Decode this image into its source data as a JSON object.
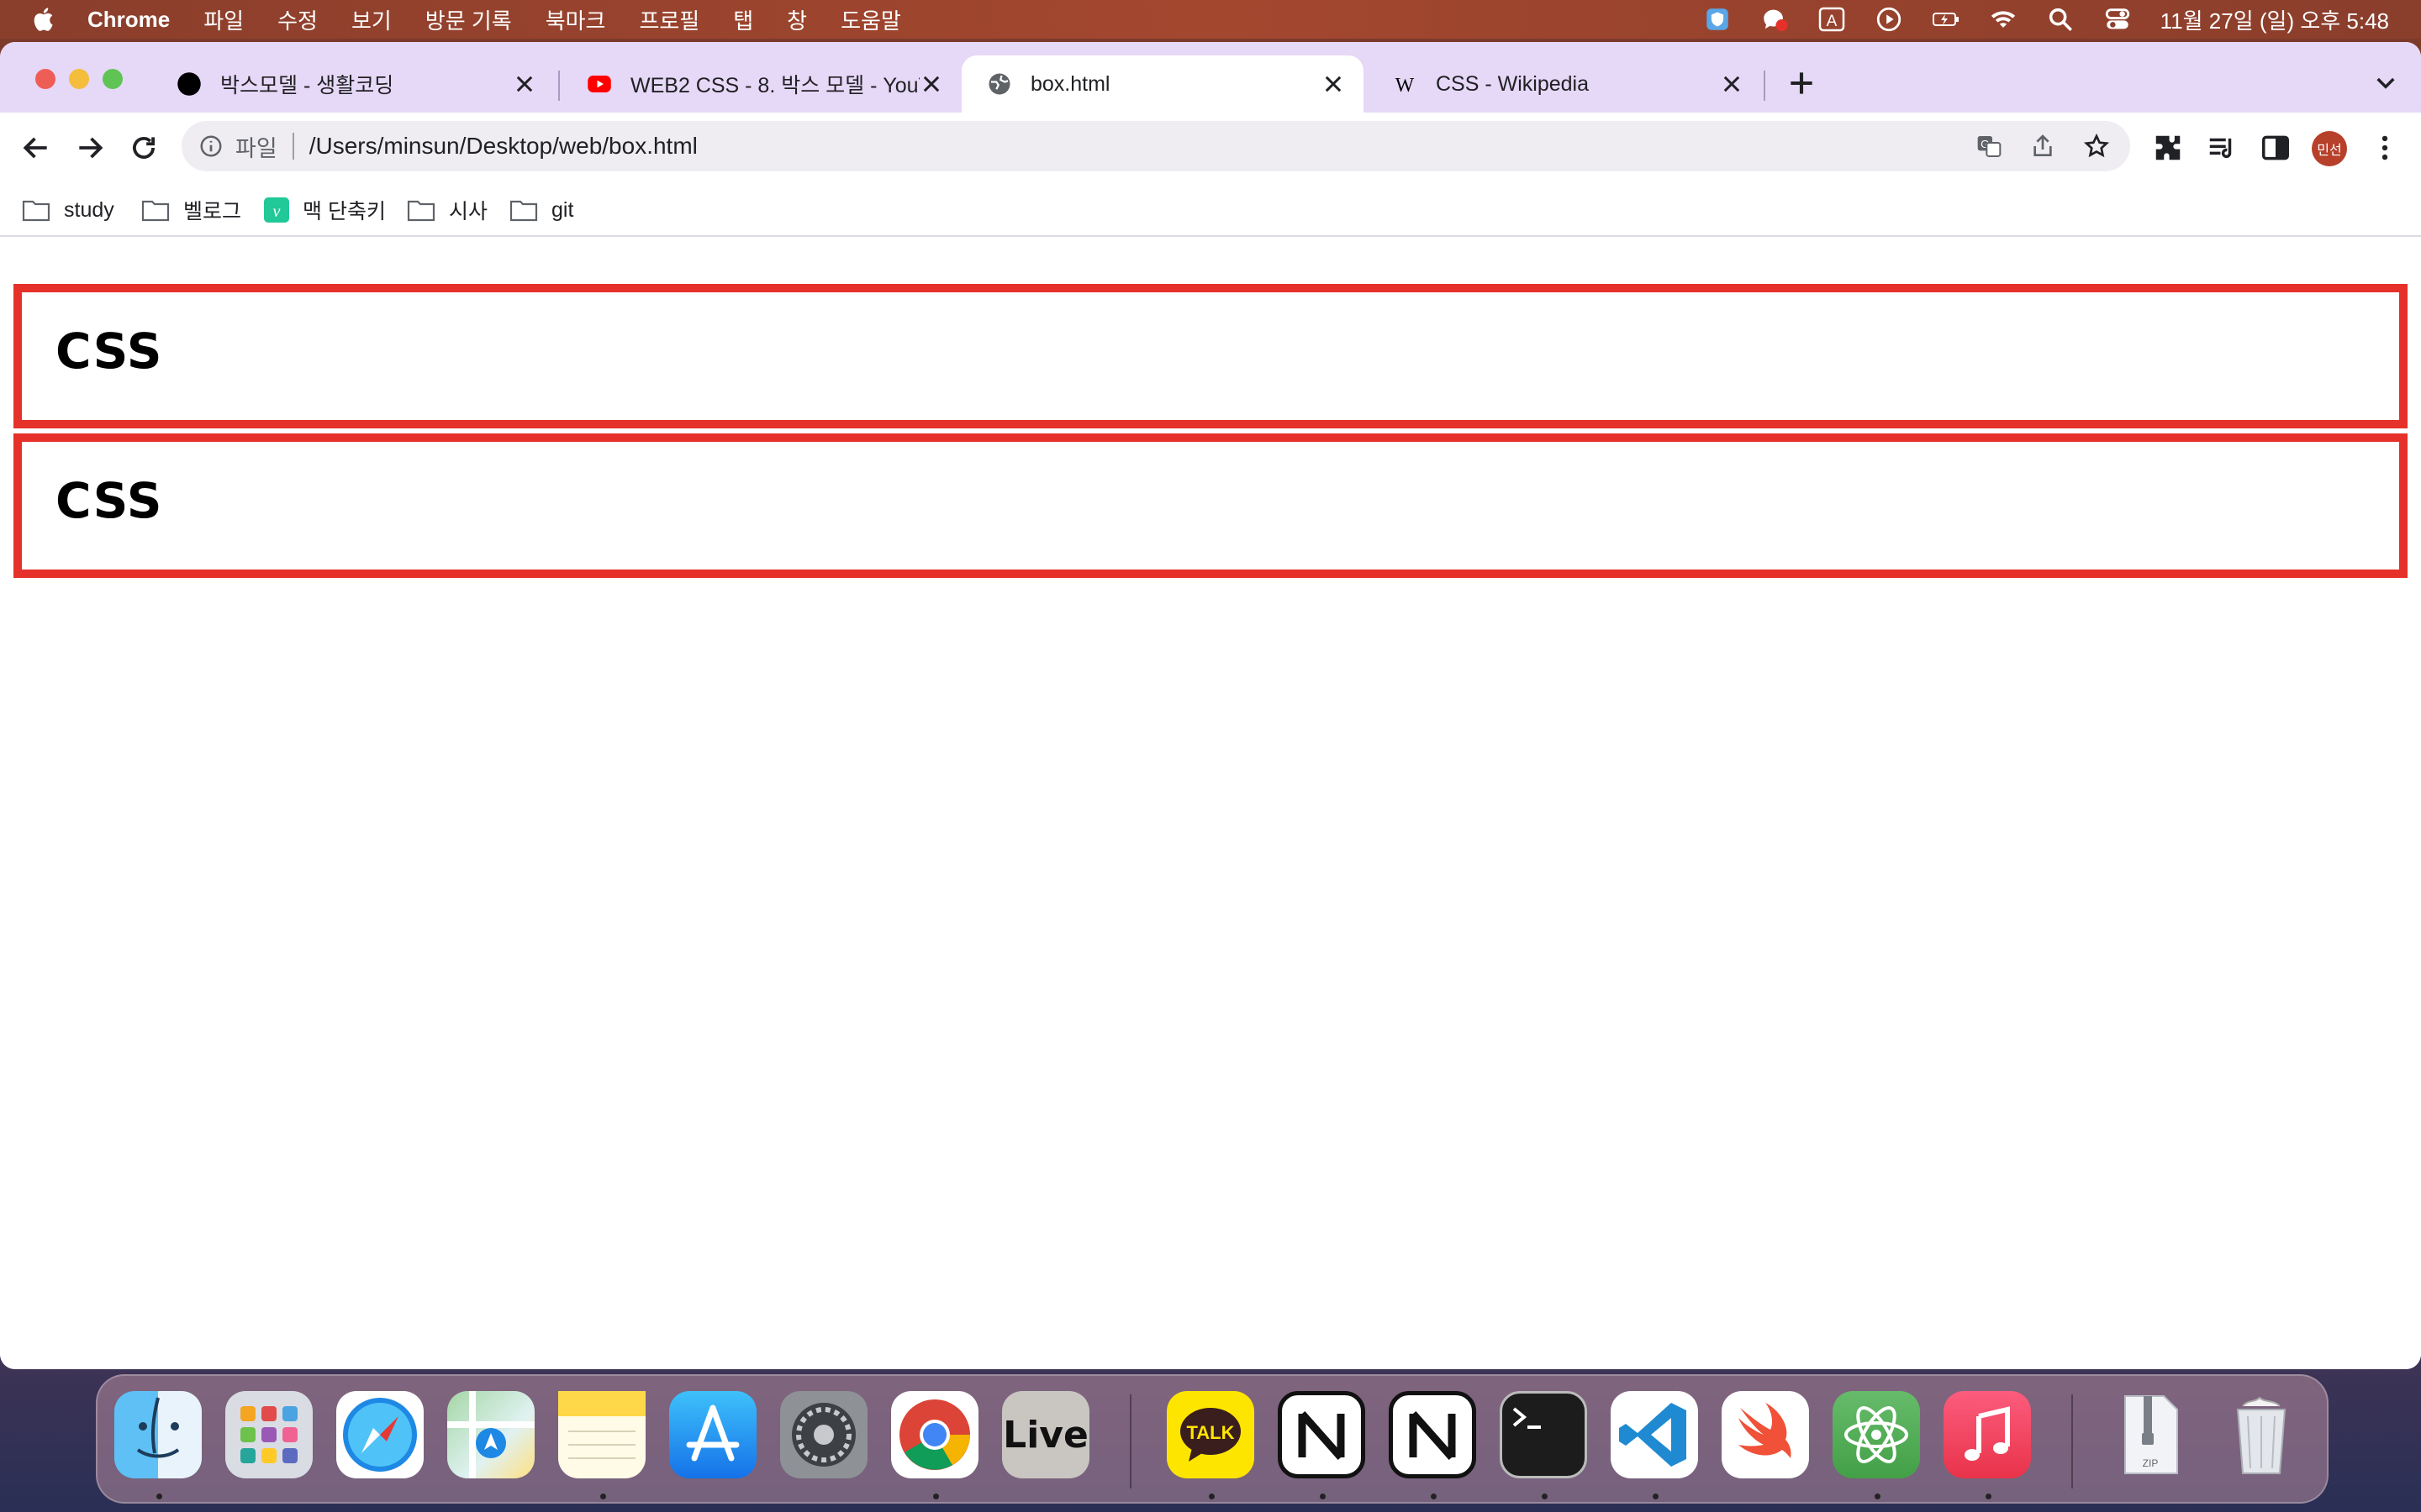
{
  "menubar": {
    "app": "Chrome",
    "items": [
      "파일",
      "수정",
      "보기",
      "방문 기록",
      "북마크",
      "프로필",
      "탭",
      "창",
      "도움말"
    ],
    "clock": "11월 27일 (일) 오후 5:48",
    "input_indicator": "A"
  },
  "tabs": [
    {
      "title": "박스모델 - 생활코딩",
      "icon": "black-circle-icon"
    },
    {
      "title": "WEB2 CSS - 8. 박스 모델 - YouTube",
      "icon": "youtube-icon"
    },
    {
      "title": "box.html",
      "icon": "globe-icon",
      "active": true
    },
    {
      "title": "CSS - Wikipedia",
      "icon": "wikipedia-icon"
    }
  ],
  "omnibox": {
    "scheme_label": "파일",
    "url": "/Users/minsun/Desktop/web/box.html"
  },
  "profile": {
    "initials": "민선"
  },
  "bookmarks": [
    {
      "label": "study",
      "icon": "folder-icon"
    },
    {
      "label": "벨로그",
      "icon": "folder-icon"
    },
    {
      "label": "맥 단축키",
      "icon": "velog-icon"
    },
    {
      "label": "시사",
      "icon": "folder-icon"
    },
    {
      "label": "git",
      "icon": "folder-icon"
    }
  ],
  "page": {
    "headings": [
      "CSS",
      "CSS"
    ],
    "box_border_color": "#e5312a"
  },
  "dock": {
    "apps": [
      "Finder",
      "Launchpad",
      "Safari",
      "Maps",
      "Notes",
      "App Store",
      "System Preferences",
      "Chrome",
      "Live",
      "KakaoTalk",
      "Notion",
      "Notion",
      "Terminal",
      "Visual Studio Code",
      "Swift Playgrounds",
      "Atom",
      "Music",
      "Archive",
      "Trash"
    ],
    "labels": {
      "live": "Live",
      "talk": "TALK",
      "zip": "ZIP"
    }
  },
  "colors": {
    "tabstrip": "#e6d8f7",
    "accent_red": "#e5312a"
  }
}
